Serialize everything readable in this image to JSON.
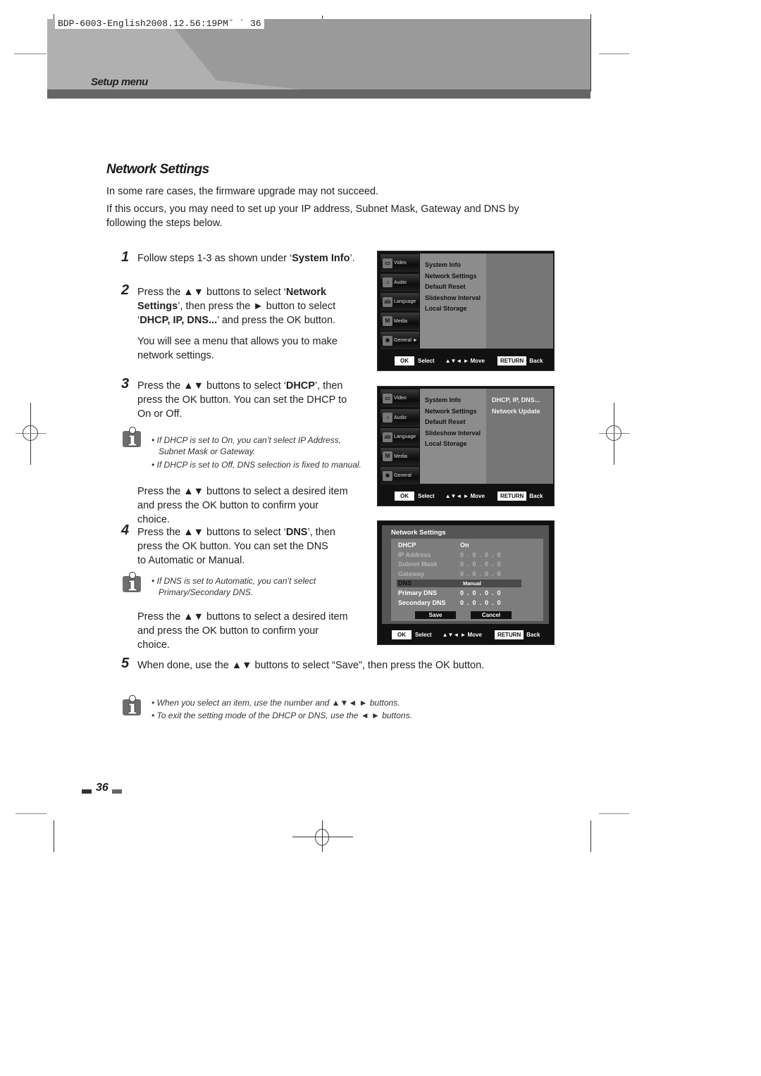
{
  "header": {
    "slug": "BDP-6003-English2008.12.56:19PM˘  ˋ  36",
    "section": "Setup menu"
  },
  "page": {
    "title": "Network Settings",
    "intro": [
      "In some rare cases, the firmware upgrade may not succeed.",
      "If this occurs, you may need to set up your IP address, Subnet Mask, Gateway and DNS by following the steps below."
    ],
    "page_number": "36"
  },
  "steps": [
    {
      "num": "1",
      "pre": "Follow steps 1-3 as shown under ‘",
      "bold": "System Info",
      "post": "’."
    },
    {
      "num": "2",
      "line1_pre": "Press the ▲▼ buttons to select ‘",
      "line1_bold": "Network Settings",
      "line1_post": "’, then press the  ► button to select ‘",
      "line2_bold": "DHCP, IP, DNS...",
      "line2_post": "’ and press the OK button.",
      "extra": "You will see a menu that allows you to make network settings."
    },
    {
      "num": "3",
      "pre": "Press the ▲▼ buttons to select ‘",
      "bold": "DHCP",
      "post": "’, then press the OK button. You can set the DHCP to On or Off.",
      "notes": [
        "• If DHCP is set to On, you can’t select IP Address,",
        "Subnet Mask or Gateway.",
        "• If DHCP is set to Off, DNS selection is fixed to manual."
      ],
      "extra": "Press the ▲▼ buttons to select a desired item and press the OK button to confirm your choice."
    },
    {
      "num": "4",
      "pre": "Press the ▲▼ buttons to select ‘",
      "bold": "DNS",
      "post": "’, then press the OK button. You can set the DNS to Automatic or Manual.",
      "notes": [
        "• If DNS is set to Automatic, you can’t select",
        "Primary/Secondary DNS."
      ],
      "extra": "Press the ▲▼ buttons to select a desired item and press the OK button to confirm your choice."
    },
    {
      "num": "5",
      "text": "When done, use  the ▲▼ buttons to select “Save”, then press the OK button."
    }
  ],
  "final_notes": [
    "• When you select an item, use the number and ▲▼◄ ► buttons.",
    "• To exit the setting mode of the DHCP or DNS, use the ◄ ► buttons."
  ],
  "tv_sidebar": [
    {
      "label": "Video",
      "icon": "tv-icon"
    },
    {
      "label": "Audio",
      "icon": "speaker-icon"
    },
    {
      "label": "Language",
      "icon": "abc-icon"
    },
    {
      "label": "Media",
      "icon": "media-icon"
    },
    {
      "label": "General",
      "icon": "gear-icon"
    }
  ],
  "tv_general_arrow": "►",
  "tv_menu": [
    "System Info",
    "Network Settings",
    "Default Reset",
    "Slideshow Interval",
    "Local Storage"
  ],
  "tv_submenu": [
    "DHCP, IP, DNS...",
    "Network Update"
  ],
  "tv_bar": {
    "ok": "OK",
    "select": "Select",
    "arrows": "▲▼◄ ►",
    "move": "Move",
    "return": "RETURN",
    "back": "Back"
  },
  "network_panel": {
    "title": "Network Settings",
    "rows": [
      {
        "label": "DHCP",
        "value": "On",
        "state": "active"
      },
      {
        "label": "IP Address",
        "value": "0  .  0  .  0  .  0",
        "state": "disabled"
      },
      {
        "label": "Subnet Mask",
        "value": "0  .  0  .  0  .  0",
        "state": "disabled"
      },
      {
        "label": "Gateway",
        "value": "0  .  0  .  0  .  0",
        "state": "disabled"
      },
      {
        "label": "DNS",
        "value": "Manual",
        "state": "highlighted"
      },
      {
        "label": "Primary DNS",
        "value": "0  .  0  .  0  .  0",
        "state": "active"
      },
      {
        "label": "Secondary DNS",
        "value": "0  .  0  .  0  .  0",
        "state": "active"
      }
    ],
    "save": "Save",
    "cancel": "Cancel"
  }
}
